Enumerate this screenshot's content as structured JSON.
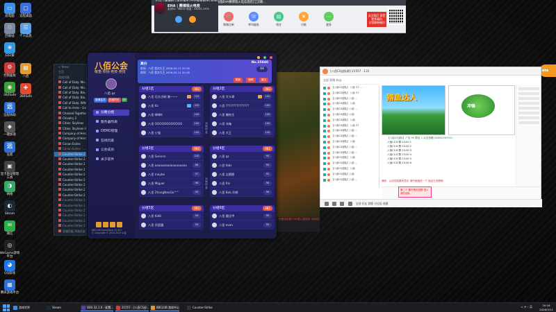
{
  "desktop": {
    "icons": [
      {
        "label": "此电脑",
        "glyph": "▭",
        "color": "#3b8fe6"
      },
      {
        "label": "回收站",
        "glyph": "♲",
        "color": "#7a8aa0"
      },
      {
        "label": "向日葵",
        "glyph": "❀",
        "color": "#2e9be6"
      },
      {
        "label": "控制面板",
        "glyph": "⚙",
        "color": "#c83a3a"
      },
      {
        "label": "360Safe",
        "glyph": "◉",
        "color": "#3c9d3a"
      },
      {
        "label": "远程协助",
        "glyph": "远",
        "color": "#2d6fd8"
      },
      {
        "label": "一键加速",
        "glyph": "◆",
        "color": "#555"
      },
      {
        "label": "远程",
        "glyph": "远",
        "color": "#2d6fd8"
      },
      {
        "label": "显卡驱动管理工具",
        "glyph": "▣",
        "color": "#444"
      },
      {
        "label": "网络",
        "glyph": "◑",
        "color": "#3a6"
      },
      {
        "label": "Steam",
        "glyph": "◐",
        "color": "#1b2838"
      },
      {
        "label": "微信",
        "glyph": "✉",
        "color": "#2bae4a"
      },
      {
        "label": "WeGame游戏平台",
        "glyph": "◎",
        "color": "#222"
      },
      {
        "label": "QQ游戏",
        "glyph": "◕",
        "color": "#1d78e6"
      },
      {
        "label": "腾讯游戏平台",
        "glyph": "▦",
        "color": "#2d6fd8"
      }
    ],
    "icons_col2": [
      {
        "label": "远程桌面",
        "glyph": "▢",
        "color": "#3b6fe0"
      },
      {
        "label": "个人信息",
        "glyph": "☰",
        "color": "#5aa0e6"
      },
      {
        "label": "八佰",
        "glyph": "Ⅲ",
        "color": "#e39b30"
      },
      {
        "label": "360Safe",
        "glyph": "✚",
        "color": "#e34b30"
      }
    ]
  },
  "banner": {
    "window_title": "EHA | 赛博现火电竞酒店 [江汉路旗舰店] 欢迎光临EHA赛博现火电竞酒店[江汉路...",
    "username": "EHA | 赛博现火电竞",
    "sub_lines": "会员ID：96552   电话：24033-1935",
    "small_buttons": [
      {
        "label": "会员中心",
        "color": "#4aa7ff"
      },
      {
        "label": "消息",
        "color": "#ff9a2f"
      }
    ],
    "tools": [
      {
        "label": "购物点单",
        "glyph": "🛒",
        "color": "#f06a6a"
      },
      {
        "label": "呼叫服务",
        "glyph": "☏",
        "color": "#5b8cff"
      },
      {
        "label": "续住",
        "glyph": "▤",
        "color": "#46c88a"
      },
      {
        "label": "付款",
        "glyph": "¥",
        "color": "#ffa53a"
      },
      {
        "label": "更多",
        "glyph": "⋯",
        "color": "#5ccf5c"
      }
    ],
    "follow_text": "关注我们 享受更多福利",
    "follow_sub": "日常都带福利"
  },
  "back_window": {
    "rows": [
      {
        "text": "< News",
        "state": "dim"
      },
      {
        "text": "主页",
        "state": "dim"
      },
      {
        "text": "游戏列表",
        "state": "dim"
      },
      {
        "text": "Call of Duty: Mo...",
        "state": ""
      },
      {
        "text": "Call of Duty: Mo...",
        "state": ""
      },
      {
        "text": "Call of Duty: Bla...",
        "state": ""
      },
      {
        "text": "Call of Duty: Bla...",
        "state": ""
      },
      {
        "text": "Call of Duty: WW...",
        "state": ""
      },
      {
        "text": "Call to Arms - Ga...",
        "state": ""
      },
      {
        "text": "Chained Together",
        "state": ""
      },
      {
        "text": "Chivalry 2",
        "state": ""
      },
      {
        "text": "Cities: Skylines",
        "state": ""
      },
      {
        "text": "Cities: Skylines II",
        "state": ""
      },
      {
        "text": "Company of Hero...",
        "state": ""
      },
      {
        "text": "Company of Hero...",
        "state": ""
      },
      {
        "text": "Conan Exiles",
        "state": ""
      },
      {
        "text": "Conan Exiles - ...",
        "state": "dim"
      },
      {
        "text": "Counter-Strike 2",
        "state": "sel"
      },
      {
        "text": "Counter-Strike 2",
        "state": ""
      },
      {
        "text": "Counter-Strike 2",
        "state": ""
      },
      {
        "text": "Counter-Strike 2",
        "state": ""
      },
      {
        "text": "Counter-Strike 2",
        "state": ""
      },
      {
        "text": "Counter-Strike 2",
        "state": ""
      },
      {
        "text": "Counter-Strike 2",
        "state": ""
      },
      {
        "text": "Counter-Strike 2",
        "state": ""
      },
      {
        "text": "Counter-Strike 2",
        "state": ""
      },
      {
        "text": "Counter-Strike 2",
        "state": "dim"
      },
      {
        "text": "Counter-Strike 2",
        "state": "dim"
      },
      {
        "text": "Counter-Strike 2",
        "state": "dim"
      },
      {
        "text": "Counter-Strike 2",
        "state": "dim"
      },
      {
        "text": "Counter-Strike 2",
        "state": "dim"
      },
      {
        "text": "Counter-Strike 2",
        "state": "dim"
      },
      {
        "text": "亚服匹配 添加好友",
        "state": "dim"
      }
    ],
    "red_bar_text": "已成功匹配-CS2进入游戏中 大约在6月份开 请留意... 预约成功 6月份匹配全开"
  },
  "guild": {
    "logo": "八佰公会",
    "slogan": "敬重·赞扬·竞技·竞技",
    "user": "八佰 qz",
    "side_buttons": [
      {
        "label": "普通会员",
        "color": "#3a6de0"
      },
      {
        "label": "在线时长",
        "color": "#e05050"
      },
      {
        "label": "4h",
        "color": "#3aa04a"
      }
    ],
    "nav": [
      {
        "label": "分路分组",
        "active": true
      },
      {
        "label": "服务器列表",
        "active": false
      },
      {
        "label": "DEMO管理",
        "active": false
      },
      {
        "label": "在线玩家",
        "active": false
      },
      {
        "label": "公会成员",
        "active": false
      },
      {
        "label": "关于软件",
        "active": false
      }
    ],
    "footer": "8BCLUB GameZone v1.327\n© Copyright © 2022-2025 公会",
    "header": {
      "title": "高分",
      "line1": "房间：八佰 首次大王  2026-03-11 20:18",
      "line2": "房间：八佰 首次大王  2026-03-11 20:18",
      "id": "No.25840",
      "count": "44",
      "buttons": [
        "刷新",
        "删除",
        "退出"
      ]
    },
    "zones": [
      {
        "title": "分组1区",
        "count": "482",
        "rows": [
          {
            "name": "八佰 后太古制 兼~~~",
            "badge": "gold",
            "ping": "100"
          },
          {
            "name": "八佰 Kz",
            "badge": "blue",
            "ping": "100"
          },
          {
            "name": "八佰 棒棒K",
            "badge": "",
            "ping": "100"
          },
          {
            "name": "八佰 OOOOOOOOOOOO",
            "badge": "",
            "ping": "100"
          },
          {
            "name": "八佰 小强",
            "badge": "",
            "ping": "100"
          }
        ]
      },
      {
        "title": "分组2区",
        "count": "482",
        "rows": [
          {
            "name": "八佰 大卡哥",
            "badge": "gold",
            "ping": "100"
          },
          {
            "name": "八佰 ???????????????",
            "badge": "",
            "ping": "100"
          },
          {
            "name": "八佰 懒先生",
            "badge": "",
            "ping": "100"
          },
          {
            "name": "八佰 冰箱",
            "badge": "",
            "ping": "100"
          },
          {
            "name": "八佰 大王",
            "badge": "",
            "ping": "100"
          }
        ]
      },
      {
        "title": "分组3区",
        "count": "482",
        "rows": [
          {
            "name": "八佰 Sonnnn",
            "badge": "",
            "ping": "100"
          },
          {
            "name": "八佰 aaaaaaaaaaaaaaaaaa",
            "badge": "",
            "ping": "88"
          },
          {
            "name": "八佰 maybe",
            "badge": "",
            "ping": "97"
          },
          {
            "name": "八佰 Miguel",
            "badge": "",
            "ping": "96"
          },
          {
            "name": "八佰 ZhongNanGe^^",
            "badge": "",
            "ping": "95"
          }
        ]
      },
      {
        "title": "分组4区",
        "count": "482",
        "rows": [
          {
            "name": "八佰 qz",
            "badge": "",
            "ping": "94"
          },
          {
            "name": "八佰 fabs",
            "badge": "",
            "ping": "94"
          },
          {
            "name": "八佰 吉鹅鹅",
            "badge": "",
            "ping": "92"
          },
          {
            "name": "八佰 Rin",
            "badge": "",
            "ping": "96"
          },
          {
            "name": "八佰 Bob 开朗",
            "badge": "",
            "ping": "96"
          }
        ]
      },
      {
        "title": "分组5区",
        "count": "482",
        "rows": [
          {
            "name": "八佰 Kid6",
            "badge": "",
            "ping": "94"
          },
          {
            "name": "八佰 吊篮圆",
            "badge": "",
            "ping": "94"
          }
        ]
      },
      {
        "title": "分组6区",
        "count": "481",
        "rows": [
          {
            "name": "八佰 量比甲",
            "badge": "",
            "ping": "95"
          },
          {
            "name": "八佰 evan",
            "badge": "",
            "ping": "95"
          }
        ]
      }
    ],
    "vertical_labels": [
      "对局信息",
      "对局信息"
    ]
  },
  "chat": {
    "title": "[八佰CS战队群]  21557  ·  131",
    "tabs": "全部    群聊    有@",
    "list": [
      "【八佰CS战队】 八佰 37 ...",
      "【八佰CS战队】 八佰 37",
      "【八佰CS战队】八佰 ...",
      "【八佰CS战队】 八佰",
      "【八佰CS战队】八佰 ...",
      "【八佰CS战队】八佰",
      "【八佰CS战队】 八佰",
      "【八佰CS战队】 八佰 37",
      "【八佰CS战队】八佰 ...",
      "【八佰CS战队】八佰 ...",
      "【八佰CS战队】 八佰",
      "【八佰CS战队】八佰 ...",
      "【八佰CS战队】八佰 ...",
      "【八佰CS战队】 八佰",
      "【八佰CS战队】八佰 ...",
      "【八佰CS战队】 八佰",
      "【八佰CS战队】八佰",
      "【八佰CS战队】八佰 ..."
    ],
    "game1_title": "猎鱼达人",
    "game2_title": "冲锋",
    "messages": [
      "八佰CS 8 群  23:00  1",
      "八佰CS 8 群  23:00  2",
      "八佰CS 8 群  23:00  3",
      "八佰CS 8 群  23:00  4",
      "八佰CS 8 群  23:00  5",
      "八佰CS 8 群  23:00  6"
    ],
    "link_text": "【八佰CS战队】广告 99 群友 1 点击查看(14690290701)",
    "notice": "通知：以后您如果有意见 请仔细描述一下 保证交流顺畅",
    "red_tip": "第二个 要开黑的进群 进入我的战队",
    "input_hint": "八佰 qz",
    "bottom": "全部      好友      群聊      讨论组      收藏"
  },
  "taskbar": {
    "items": [
      {
        "label": "游戏世界",
        "color": "#3a8de0",
        "active": false
      },
      {
        "label": "Steam",
        "color": "#1b2838",
        "active": false
      },
      {
        "label": "OBS 32.1.0 - 配置...",
        "color": "#5a3fa8",
        "active": true
      },
      {
        "label": "21557 - [八佰CS战...",
        "color": "#d83a3a",
        "active": true
      },
      {
        "label": "8BCLUB 游戏中心",
        "color": "#e39b30",
        "active": true
      },
      {
        "label": "Counter-Strike",
        "color": "#333",
        "active": false
      }
    ],
    "tray": "∧  ◔  ⌁  英",
    "time": "20:16",
    "date": "2026/3/11"
  },
  "colors": {
    "accent": "#4a3fb4",
    "zone_count": "#e85d3c",
    "logo": "#ffb338"
  }
}
